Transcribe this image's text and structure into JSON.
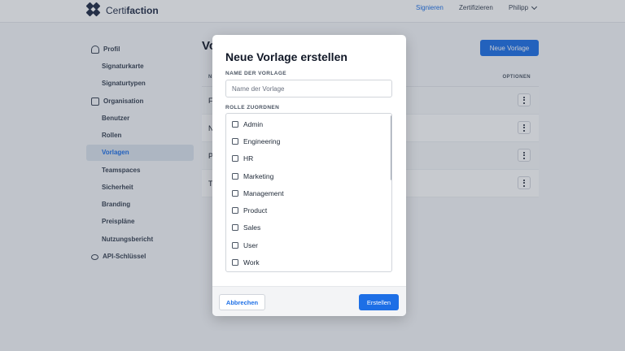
{
  "header": {
    "logo_light": "Certi",
    "logo_bold": "faction",
    "nav": {
      "sign": "Signieren",
      "certify": "Zertifizieren",
      "user": "Philipp"
    }
  },
  "sidebar": {
    "profile": {
      "label": "Profil",
      "items": [
        "Signaturkarte",
        "Signaturtypen"
      ]
    },
    "organisation": {
      "label": "Organisation",
      "items": [
        "Benutzer",
        "Rollen",
        "Vorlagen",
        "Teamspaces",
        "Sicherheit",
        "Branding",
        "Preispläne",
        "Nutzungsbericht"
      ]
    },
    "api_key": "API-Schlüssel",
    "active": "Vorlagen"
  },
  "main": {
    "title_visible": "Vo",
    "new_button": "Neue Vorlage",
    "table": {
      "col_name_visible": "N",
      "col_options": "OPTIONEN",
      "row_initials": [
        "F",
        "N",
        "P",
        "T"
      ]
    }
  },
  "modal": {
    "title": "Neue Vorlage erstellen",
    "name_label": "NAME DER VORLAGE",
    "name_placeholder": "Name der Vorlage",
    "name_value": "",
    "role_label": "ROLLE ZUORDNEN",
    "roles": [
      "Admin",
      "Engineering",
      "HR",
      "Marketing",
      "Management",
      "Product",
      "Sales",
      "User",
      "Work"
    ],
    "cancel": "Abbrechen",
    "create": "Erstellen"
  },
  "colors": {
    "accent": "#1d6fe6",
    "overlay": "#374151"
  }
}
